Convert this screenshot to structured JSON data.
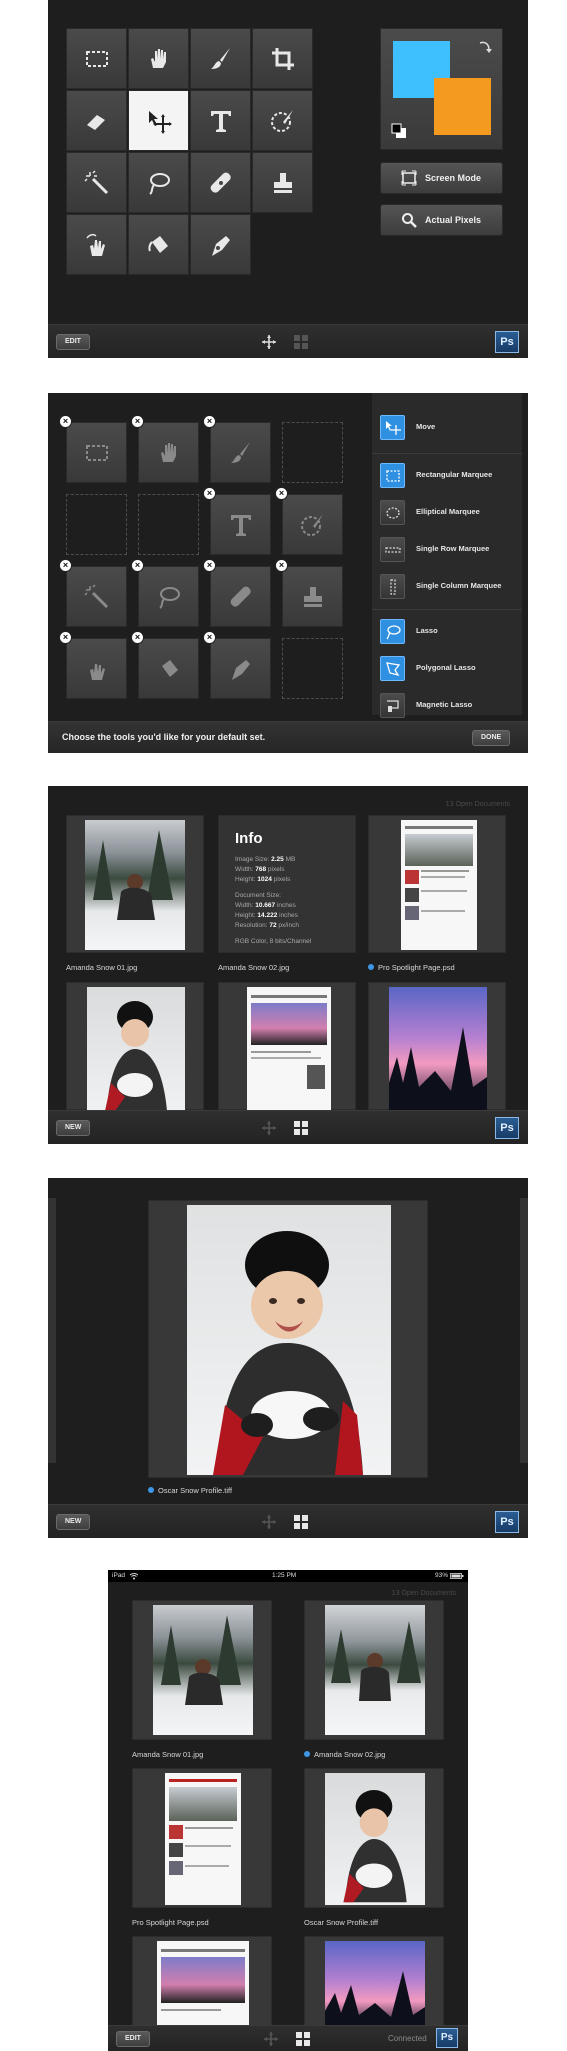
{
  "panel1": {
    "tools": [
      "rect-marquee",
      "hand",
      "brush",
      "crop",
      "eraser",
      "move",
      "text",
      "quick-select",
      "magic-wand",
      "lasso",
      "healing",
      "stamp",
      "smudge",
      "paint-bucket",
      "pen"
    ],
    "selected_tool": "move",
    "foreground_color": "#3ec0ff",
    "background_color": "#f49a1e",
    "screen_mode_label": "Screen Mode",
    "actual_pixels_label": "Actual Pixels",
    "edit_label": "EDIT",
    "ps_label": "Ps"
  },
  "panel2": {
    "hint": "Choose the tools you'd like for your default set.",
    "done_label": "DONE",
    "tool_list": [
      {
        "label": "Move",
        "icon": "move",
        "active": true
      },
      {
        "label": "Rectangular Marquee",
        "icon": "rect-marquee",
        "active": true
      },
      {
        "label": "Elliptical Marquee",
        "icon": "ellipse-marquee",
        "active": false
      },
      {
        "label": "Single Row Marquee",
        "icon": "single-row",
        "active": false
      },
      {
        "label": "Single Column Marquee",
        "icon": "single-col",
        "active": false
      },
      {
        "label": "Lasso",
        "icon": "lasso",
        "active": true
      },
      {
        "label": "Polygonal Lasso",
        "icon": "poly-lasso",
        "active": true
      },
      {
        "label": "Magnetic Lasso",
        "icon": "mag-lasso",
        "active": false
      }
    ]
  },
  "panel3": {
    "open_docs": "13 Open Documents",
    "info": {
      "title": "Info",
      "image_size_label": "Image Size:",
      "image_size": "2.25",
      "image_size_unit": "MB",
      "width_label": "Width:",
      "width": "768",
      "width_unit": "pixels",
      "height_label": "Height:",
      "height": "1024",
      "height_unit": "pixels",
      "doc_size_label": "Document Size:",
      "dwidth_label": "Width:",
      "dwidth": "10.667",
      "dwidth_unit": "inches",
      "dheight_label": "Height:",
      "dheight": "14.222",
      "dheight_unit": "inches",
      "res_label": "Resolution:",
      "res": "72",
      "res_unit": "px/inch",
      "color": "RGB Color, 8 bits/Channel"
    },
    "captions": [
      "Amanda Snow 01.jpg",
      "Amanda Snow 02.jpg",
      "Pro Spotlight Page.psd"
    ],
    "new_label": "NEW",
    "ps_label": "Ps"
  },
  "panel4": {
    "caption": "Oscar Snow Profile.tiff",
    "new_label": "NEW",
    "ps_label": "Ps"
  },
  "panel5": {
    "status_left": "iPad",
    "status_time": "1:25 PM",
    "status_battery": "93%",
    "open_docs": "13 Open Documents",
    "captions": [
      "Amanda Snow 01.jpg",
      "Amanda Snow 02.jpg",
      "Pro Spotlight Page.psd",
      "Oscar Snow Profile.tiff"
    ],
    "edit_label": "EDIT",
    "connected": "Connected",
    "ps_label": "Ps"
  }
}
